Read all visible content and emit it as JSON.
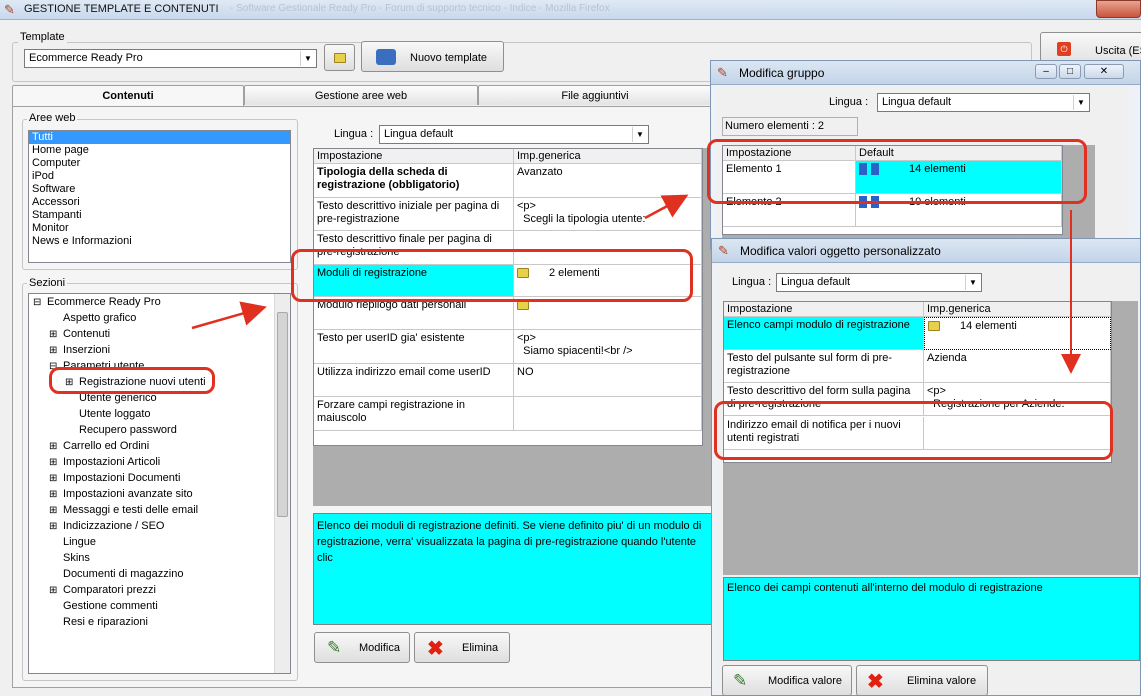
{
  "window": {
    "title": "GESTIONE TEMPLATE E CONTENUTI",
    "faded_title": "- Software Gestionale Ready Pro - Forum di supporto tecnico - Indice - Mozilla Firefox"
  },
  "template": {
    "legend": "Template",
    "selected": "Ecommerce Ready Pro",
    "new_button": "Nuovo template"
  },
  "exit": {
    "label": "Uscita (ES"
  },
  "tabs": [
    {
      "label": "Contenuti"
    },
    {
      "label": "Gestione aree web"
    },
    {
      "label": "File aggiuntivi"
    }
  ],
  "aree_web": {
    "legend": "Aree web",
    "items": [
      "Tutti",
      "Home page",
      "Computer",
      "iPod",
      "Software",
      "Accessori",
      "Stampanti",
      "Monitor",
      "News e Informazioni"
    ]
  },
  "sezioni": {
    "legend": "Sezioni",
    "items": [
      {
        "label": "Ecommerce Ready Pro",
        "prefix": "⊟"
      },
      {
        "label": "Aspetto grafico",
        "prefix": ""
      },
      {
        "label": "Contenuti",
        "prefix": "⊞"
      },
      {
        "label": "Inserzioni",
        "prefix": "⊞"
      },
      {
        "label": "Parametri utente",
        "prefix": "⊟"
      },
      {
        "label": "Registrazione nuovi utenti",
        "prefix": "⊞"
      },
      {
        "label": "Utente generico",
        "prefix": ""
      },
      {
        "label": "Utente loggato",
        "prefix": ""
      },
      {
        "label": "Recupero password",
        "prefix": ""
      },
      {
        "label": "Carrello ed Ordini",
        "prefix": "⊞"
      },
      {
        "label": "Impostazioni Articoli",
        "prefix": "⊞"
      },
      {
        "label": "Impostazioni Documenti",
        "prefix": "⊞"
      },
      {
        "label": "Impostazioni avanzate sito",
        "prefix": "⊞"
      },
      {
        "label": "Messaggi e testi delle email",
        "prefix": "⊞"
      },
      {
        "label": "Indicizzazione / SEO",
        "prefix": "⊞"
      },
      {
        "label": "Lingue",
        "prefix": ""
      },
      {
        "label": "Skins",
        "prefix": ""
      },
      {
        "label": "Documenti di magazzino",
        "prefix": ""
      },
      {
        "label": "Comparatori prezzi",
        "prefix": "⊞"
      },
      {
        "label": "Gestione commenti",
        "prefix": ""
      },
      {
        "label": "Resi e riparazioni",
        "prefix": ""
      }
    ]
  },
  "main": {
    "lingua_label": "Lingua :",
    "lingua_value": "Lingua default",
    "col1": "Impostazione",
    "col2": "Imp.generica",
    "rows": [
      {
        "name": "Tipologia della scheda di registrazione (obbligatorio)",
        "value": "Avanzato"
      },
      {
        "name": "Testo descrittivo iniziale per pagina di pre-registrazione",
        "value": "<p>\n  Scegli la tipologia utente:"
      },
      {
        "name": "Testo descrittivo finale per pagina di pre-registrazione",
        "value": ""
      },
      {
        "name": "Moduli di registrazione",
        "value": "2 elementi"
      },
      {
        "name": "Modulo riepilogo dati personali",
        "value": ""
      },
      {
        "name": "Testo per userID gia' esistente",
        "value": "<p>\n  Siamo spiacenti!<br />"
      },
      {
        "name": "Utilizza indirizzo email come userID",
        "value": "NO"
      },
      {
        "name": "Forzare campi registrazione in maiuscolo",
        "value": ""
      }
    ],
    "description": "Elenco dei moduli di registrazione definiti. Se viene definito piu' di un modulo di registrazione, verra' visualizzata la pagina di pre-registrazione quando l'utente clic",
    "modifica": "Modifica",
    "elimina": "Elimina"
  },
  "gruppo": {
    "title": "Modifica gruppo",
    "lingua_label": "Lingua :",
    "lingua_value": "Lingua default",
    "count": "Numero elementi : 2",
    "col1": "Impostazione",
    "col2": "Default",
    "rows": [
      {
        "name": "Elemento 1",
        "value": "14 elementi"
      },
      {
        "name": "Elemento 2",
        "value": "10 elementi"
      }
    ]
  },
  "oggetto": {
    "title": "Modifica valori oggetto personalizzato",
    "lingua_label": "Lingua :",
    "lingua_value": "Lingua default",
    "col1": "Impostazione",
    "col2": "Imp.generica",
    "rows": [
      {
        "name": "Elenco campi modulo di registrazione",
        "value": "14 elementi"
      },
      {
        "name": "Testo del pulsante sul form di pre-registrazione",
        "value": "Azienda"
      },
      {
        "name": "Testo descrittivo del form sulla pagina di pre-registrazione",
        "value": "<p>\n  Registrazione per Aziende."
      },
      {
        "name": "Indirizzo email di notifica per i nuovi utenti registrati",
        "value": ""
      }
    ],
    "description": "Elenco dei campi contenuti all'interno del modulo di registrazione",
    "modifica": "Modifica valore",
    "elimina": "Elimina valore"
  },
  "colors": {
    "highlight": "#00ffff",
    "annotation": "#e03020",
    "selection": "#3399ff"
  }
}
